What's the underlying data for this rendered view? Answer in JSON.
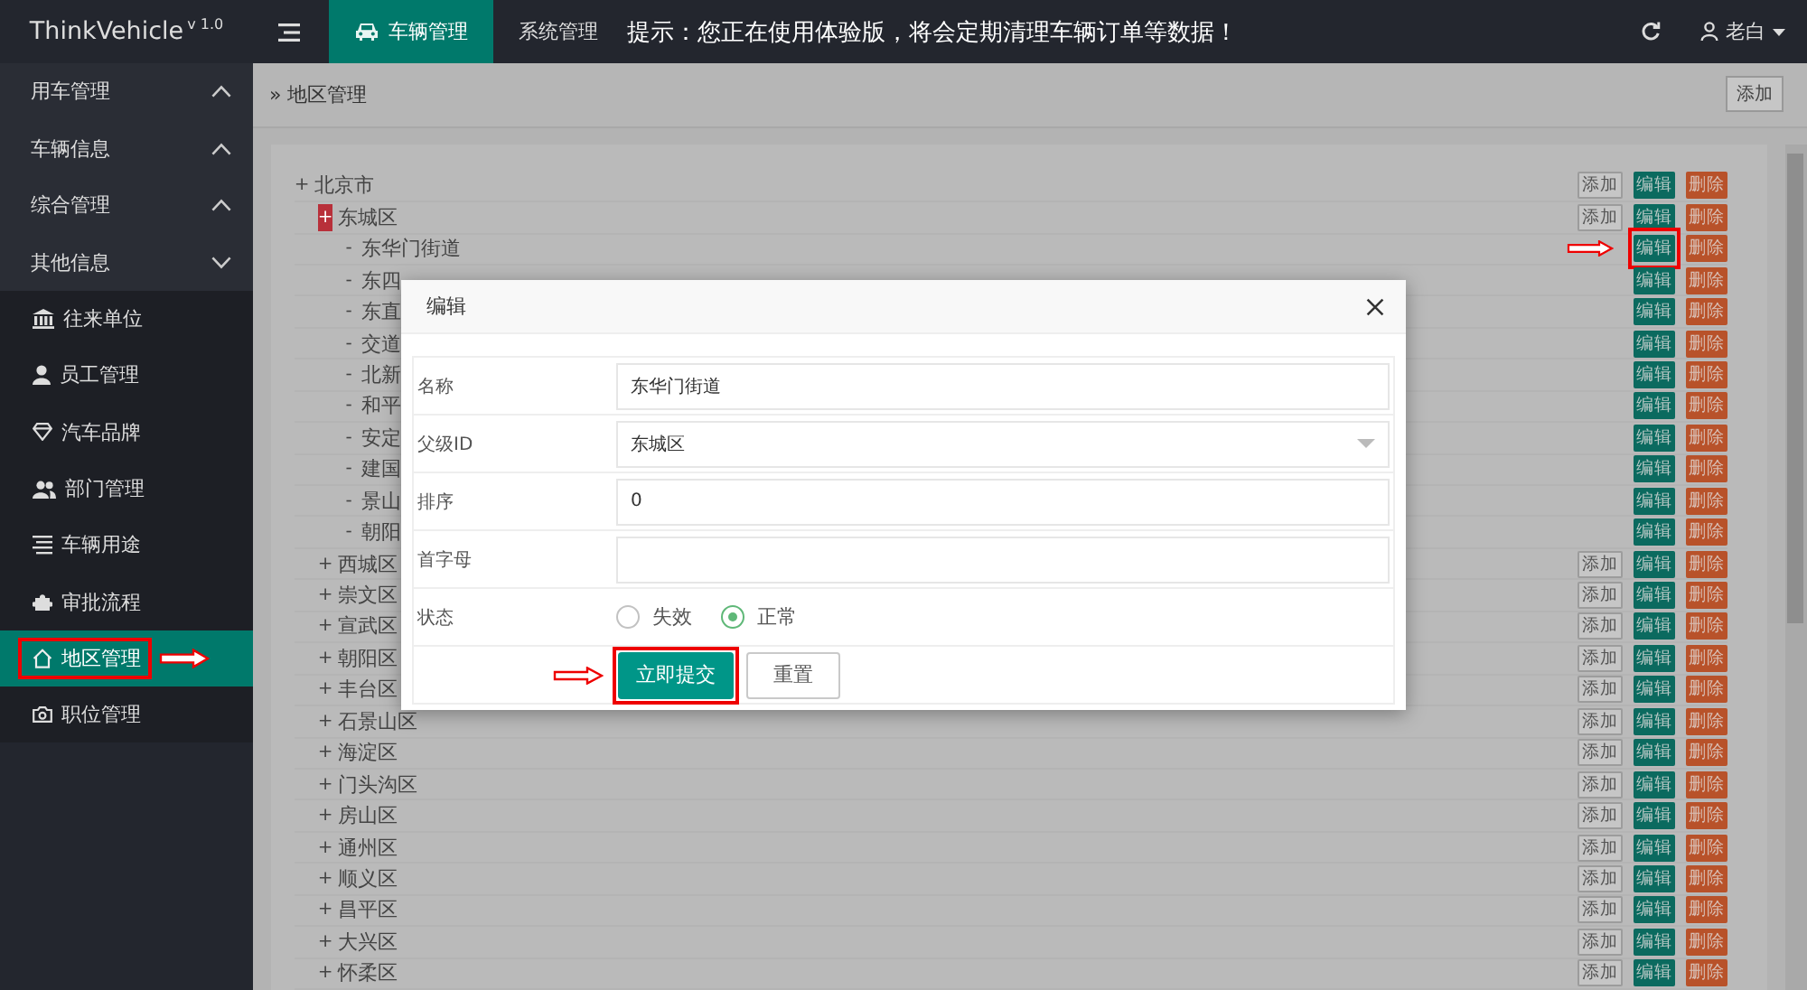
{
  "header": {
    "logo": "ThinkVehicle",
    "version": "v 1.0",
    "tabs": [
      {
        "label": "车辆管理",
        "selected": true
      },
      {
        "label": "系统管理",
        "selected": false
      }
    ],
    "notice": "提示：您正在使用体验版，将会定期清理车辆订单等数据！",
    "user": "老白"
  },
  "sidebar": {
    "groups": [
      {
        "label": "用车管理",
        "expanded": false
      },
      {
        "label": "车辆信息",
        "expanded": false
      },
      {
        "label": "综合管理",
        "expanded": false
      },
      {
        "label": "其他信息",
        "expanded": true,
        "items": [
          {
            "label": "往来单位",
            "selected": false,
            "highlighted": false
          },
          {
            "label": "员工管理",
            "selected": false,
            "highlighted": false
          },
          {
            "label": "汽车品牌",
            "selected": false,
            "highlighted": false
          },
          {
            "label": "部门管理",
            "selected": false,
            "highlighted": false
          },
          {
            "label": "车辆用途",
            "selected": false,
            "highlighted": false
          },
          {
            "label": "审批流程",
            "selected": false,
            "highlighted": false
          },
          {
            "label": "地区管理",
            "selected": true,
            "highlighted": true
          },
          {
            "label": "职位管理",
            "selected": false,
            "highlighted": false
          }
        ]
      }
    ]
  },
  "breadcrumb": {
    "separator": "»",
    "label": "地区管理",
    "button": "添加"
  },
  "tree": [
    {
      "toggle": "+",
      "label": "北京市",
      "focused": false,
      "highlighted": false,
      "actions": [
        {
          "kind": "add",
          "label": "添加"
        },
        {
          "kind": "edit",
          "label": "编辑"
        },
        {
          "kind": "delete",
          "label": "删除"
        }
      ],
      "children": [
        {
          "toggle": "+",
          "label": "东城区",
          "focused": true,
          "highlighted": false,
          "actions": [
            {
              "kind": "add",
              "label": "添加"
            },
            {
              "kind": "edit",
              "label": "编辑"
            },
            {
              "kind": "delete",
              "label": "删除"
            }
          ],
          "children": [
            {
              "toggle": "-",
              "label": "东华门街道",
              "focused": false,
              "highlighted": true,
              "actions": [
                {
                  "kind": "edit",
                  "label": "编辑"
                },
                {
                  "kind": "delete",
                  "label": "删除"
                }
              ]
            },
            {
              "toggle": "-",
              "label": "东四",
              "focused": false,
              "highlighted": false,
              "actions": [
                {
                  "kind": "edit",
                  "label": "编辑"
                },
                {
                  "kind": "delete",
                  "label": "删除"
                }
              ]
            },
            {
              "toggle": "-",
              "label": "东直",
              "focused": false,
              "highlighted": false,
              "actions": [
                {
                  "kind": "edit",
                  "label": "编辑"
                },
                {
                  "kind": "delete",
                  "label": "删除"
                }
              ]
            },
            {
              "toggle": "-",
              "label": "交道",
              "focused": false,
              "highlighted": false,
              "actions": [
                {
                  "kind": "edit",
                  "label": "编辑"
                },
                {
                  "kind": "delete",
                  "label": "删除"
                }
              ]
            },
            {
              "toggle": "-",
              "label": "北新",
              "focused": false,
              "highlighted": false,
              "actions": [
                {
                  "kind": "edit",
                  "label": "编辑"
                },
                {
                  "kind": "delete",
                  "label": "删除"
                }
              ]
            },
            {
              "toggle": "-",
              "label": "和平",
              "focused": false,
              "highlighted": false,
              "actions": [
                {
                  "kind": "edit",
                  "label": "编辑"
                },
                {
                  "kind": "delete",
                  "label": "删除"
                }
              ]
            },
            {
              "toggle": "-",
              "label": "安定",
              "focused": false,
              "highlighted": false,
              "actions": [
                {
                  "kind": "edit",
                  "label": "编辑"
                },
                {
                  "kind": "delete",
                  "label": "删除"
                }
              ]
            },
            {
              "toggle": "-",
              "label": "建国",
              "focused": false,
              "highlighted": false,
              "actions": [
                {
                  "kind": "edit",
                  "label": "编辑"
                },
                {
                  "kind": "delete",
                  "label": "删除"
                }
              ]
            },
            {
              "toggle": "-",
              "label": "景山",
              "focused": false,
              "highlighted": false,
              "actions": [
                {
                  "kind": "edit",
                  "label": "编辑"
                },
                {
                  "kind": "delete",
                  "label": "删除"
                }
              ]
            },
            {
              "toggle": "-",
              "label": "朝阳",
              "focused": false,
              "highlighted": false,
              "actions": [
                {
                  "kind": "edit",
                  "label": "编辑"
                },
                {
                  "kind": "delete",
                  "label": "删除"
                }
              ]
            }
          ]
        },
        {
          "toggle": "+",
          "label": "西城区",
          "focused": false,
          "highlighted": false,
          "actions": [
            {
              "kind": "add",
              "label": "添加"
            },
            {
              "kind": "edit",
              "label": "编辑"
            },
            {
              "kind": "delete",
              "label": "删除"
            }
          ]
        },
        {
          "toggle": "+",
          "label": "崇文区",
          "focused": false,
          "highlighted": false,
          "actions": [
            {
              "kind": "add",
              "label": "添加"
            },
            {
              "kind": "edit",
              "label": "编辑"
            },
            {
              "kind": "delete",
              "label": "删除"
            }
          ]
        },
        {
          "toggle": "+",
          "label": "宣武区",
          "focused": false,
          "highlighted": false,
          "actions": [
            {
              "kind": "add",
              "label": "添加"
            },
            {
              "kind": "edit",
              "label": "编辑"
            },
            {
              "kind": "delete",
              "label": "删除"
            }
          ]
        },
        {
          "toggle": "+",
          "label": "朝阳区",
          "focused": false,
          "highlighted": false,
          "actions": [
            {
              "kind": "add",
              "label": "添加"
            },
            {
              "kind": "edit",
              "label": "编辑"
            },
            {
              "kind": "delete",
              "label": "删除"
            }
          ]
        },
        {
          "toggle": "+",
          "label": "丰台区",
          "focused": false,
          "highlighted": false,
          "actions": [
            {
              "kind": "add",
              "label": "添加"
            },
            {
              "kind": "edit",
              "label": "编辑"
            },
            {
              "kind": "delete",
              "label": "删除"
            }
          ]
        },
        {
          "toggle": "+",
          "label": "石景山区",
          "focused": false,
          "highlighted": false,
          "actions": [
            {
              "kind": "add",
              "label": "添加"
            },
            {
              "kind": "edit",
              "label": "编辑"
            },
            {
              "kind": "delete",
              "label": "删除"
            }
          ]
        },
        {
          "toggle": "+",
          "label": "海淀区",
          "focused": false,
          "highlighted": false,
          "actions": [
            {
              "kind": "add",
              "label": "添加"
            },
            {
              "kind": "edit",
              "label": "编辑"
            },
            {
              "kind": "delete",
              "label": "删除"
            }
          ]
        },
        {
          "toggle": "+",
          "label": "门头沟区",
          "focused": false,
          "highlighted": false,
          "actions": [
            {
              "kind": "add",
              "label": "添加"
            },
            {
              "kind": "edit",
              "label": "编辑"
            },
            {
              "kind": "delete",
              "label": "删除"
            }
          ]
        },
        {
          "toggle": "+",
          "label": "房山区",
          "focused": false,
          "highlighted": false,
          "actions": [
            {
              "kind": "add",
              "label": "添加"
            },
            {
              "kind": "edit",
              "label": "编辑"
            },
            {
              "kind": "delete",
              "label": "删除"
            }
          ]
        },
        {
          "toggle": "+",
          "label": "通州区",
          "focused": false,
          "highlighted": false,
          "actions": [
            {
              "kind": "add",
              "label": "添加"
            },
            {
              "kind": "edit",
              "label": "编辑"
            },
            {
              "kind": "delete",
              "label": "删除"
            }
          ]
        },
        {
          "toggle": "+",
          "label": "顺义区",
          "focused": false,
          "highlighted": false,
          "actions": [
            {
              "kind": "add",
              "label": "添加"
            },
            {
              "kind": "edit",
              "label": "编辑"
            },
            {
              "kind": "delete",
              "label": "删除"
            }
          ]
        },
        {
          "toggle": "+",
          "label": "昌平区",
          "focused": false,
          "highlighted": false,
          "actions": [
            {
              "kind": "add",
              "label": "添加"
            },
            {
              "kind": "edit",
              "label": "编辑"
            },
            {
              "kind": "delete",
              "label": "删除"
            }
          ]
        },
        {
          "toggle": "+",
          "label": "大兴区",
          "focused": false,
          "highlighted": false,
          "actions": [
            {
              "kind": "add",
              "label": "添加"
            },
            {
              "kind": "edit",
              "label": "编辑"
            },
            {
              "kind": "delete",
              "label": "删除"
            }
          ]
        },
        {
          "toggle": "+",
          "label": "怀柔区",
          "focused": false,
          "highlighted": false,
          "actions": [
            {
              "kind": "add",
              "label": "添加"
            },
            {
              "kind": "edit",
              "label": "编辑"
            },
            {
              "kind": "delete",
              "label": "删除"
            }
          ]
        }
      ]
    }
  ],
  "dialog": {
    "title": "编辑",
    "fields": [
      {
        "label": "名称",
        "kind": "text",
        "value": "东华门街道"
      },
      {
        "label": "父级ID",
        "kind": "select",
        "value": "东城区"
      },
      {
        "label": "排序",
        "kind": "text",
        "value": "0"
      },
      {
        "label": "首字母",
        "kind": "text"
      },
      {
        "label": "状态",
        "kind": "radio",
        "options": [
          {
            "label": "失效",
            "selected": false
          },
          {
            "label": "正常",
            "selected": true
          }
        ]
      }
    ],
    "buttons": [
      {
        "label": "立即提交",
        "kind": "primary",
        "highlighted": true
      },
      {
        "label": "重置",
        "kind": "default",
        "highlighted": false
      }
    ]
  }
}
